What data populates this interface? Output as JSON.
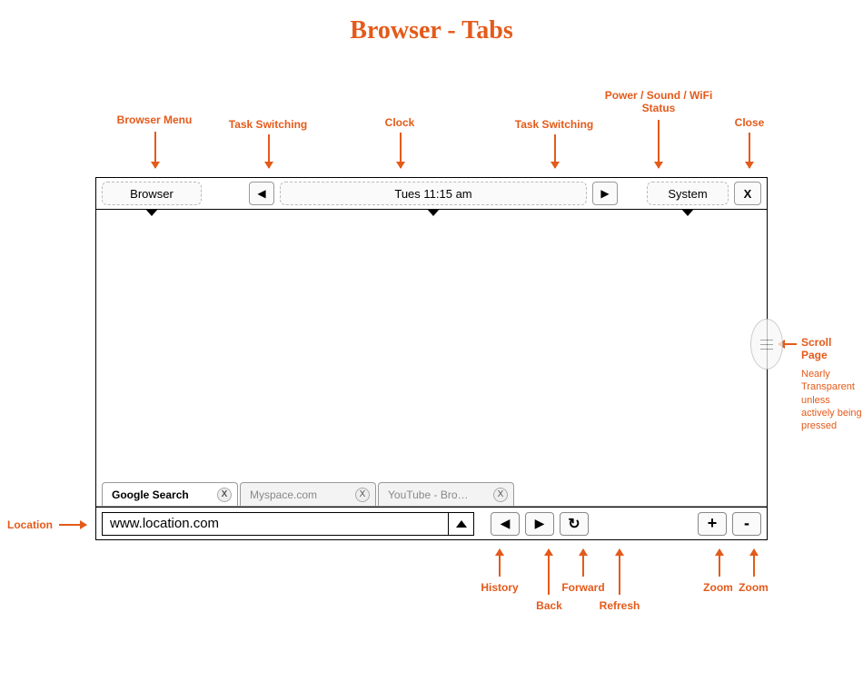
{
  "title": "Browser - Tabs",
  "annotations": {
    "browser_menu": "Browser Menu",
    "task_switching_left": "Task Switching",
    "clock": "Clock",
    "task_switching_right": "Task Switching",
    "power_sound_wifi": "Power / Sound / WiFi Status",
    "close": "Close",
    "scroll_page": "Scroll Page",
    "scroll_note": "Nearly Transparent unless actively being pressed",
    "location": "Location",
    "history": "History",
    "back": "Back",
    "forward": "Forward",
    "refresh": "Refresh",
    "zoom_in": "Zoom",
    "zoom_out": "Zoom"
  },
  "topbar": {
    "browser_label": "Browser",
    "prev_glyph": "◀",
    "clock_label": "Tues 11:15 am",
    "next_glyph": "▶",
    "system_label": "System",
    "close_glyph": "X"
  },
  "tabs": [
    {
      "label": "Google Search",
      "close": "X",
      "active": true
    },
    {
      "label": "Myspace.com",
      "close": "X",
      "active": false
    },
    {
      "label": "YouTube - Bro…",
      "close": "X",
      "active": false
    }
  ],
  "bottombar": {
    "location_value": "www.location.com",
    "history_glyph": "▲",
    "back_glyph": "◀",
    "forward_glyph": "▶",
    "refresh_glyph": "↻",
    "zoom_in_glyph": "+",
    "zoom_out_glyph": "-"
  }
}
